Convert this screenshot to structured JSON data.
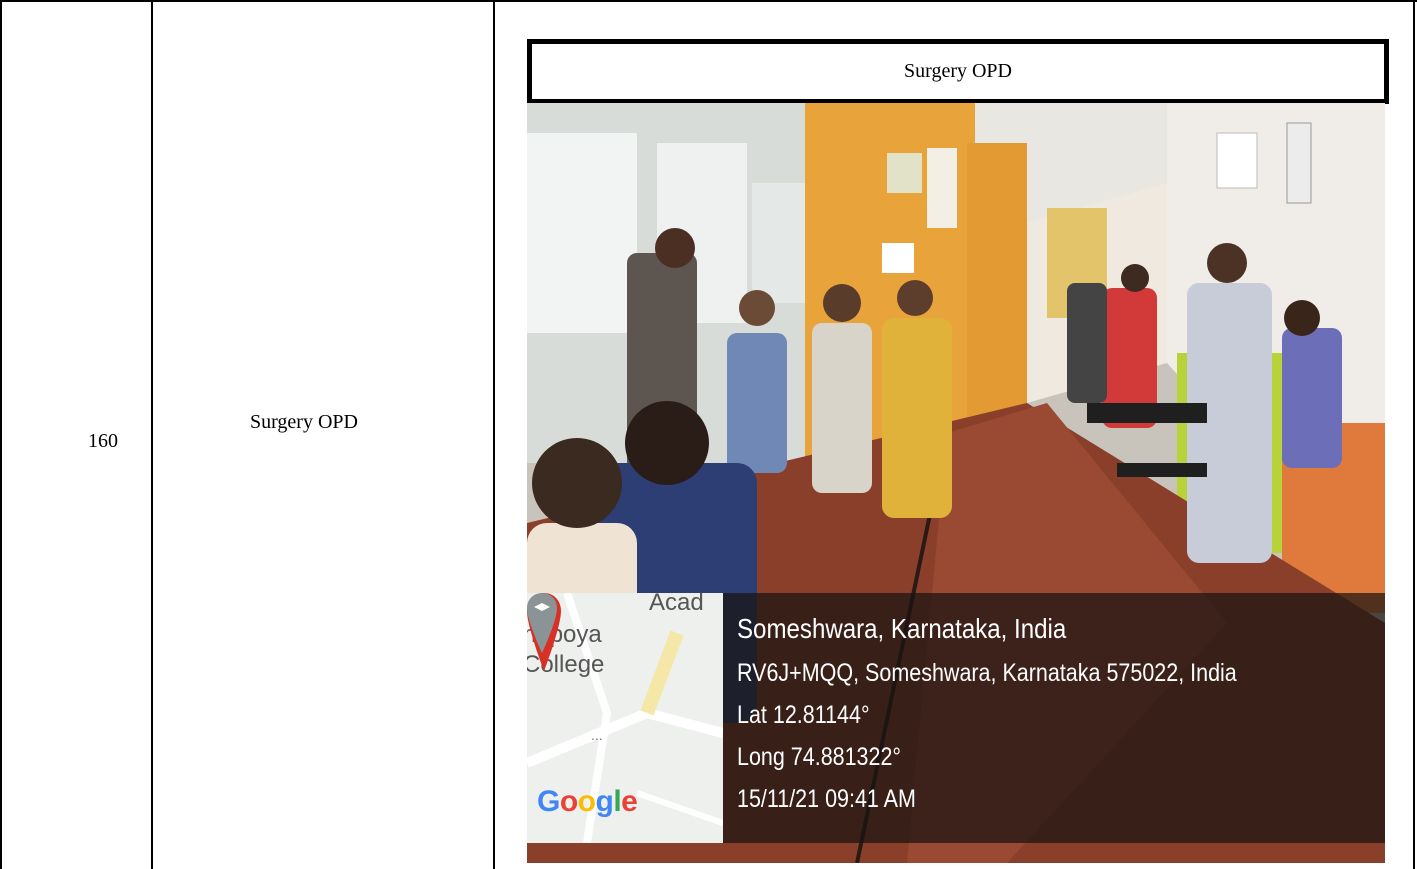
{
  "row": {
    "serial_no": "160",
    "location": "Surgery OPD"
  },
  "photo": {
    "caption": "Surgery OPD"
  },
  "geotag": {
    "map_labels": {
      "acad": "Acad",
      "nepoya": "nepoya",
      "college": "College",
      "dots": "..."
    },
    "google_logo": [
      "G",
      "o",
      "o",
      "g",
      "l",
      "e"
    ],
    "place": "Someshwara, Karnataka, India",
    "address": "RV6J+MQQ, Someshwara, Karnataka 575022, India",
    "latitude": "Lat 12.81144°",
    "longitude": "Long 74.881322°",
    "timestamp": "15/11/21 09:41 AM"
  },
  "colors": {
    "pin": "#d93025",
    "overlay": "#191412",
    "floor": "#8a3f2a",
    "wall_orange": "#e8a33a"
  },
  "icons": [
    "map-pin-icon",
    "school-pin-icon"
  ]
}
